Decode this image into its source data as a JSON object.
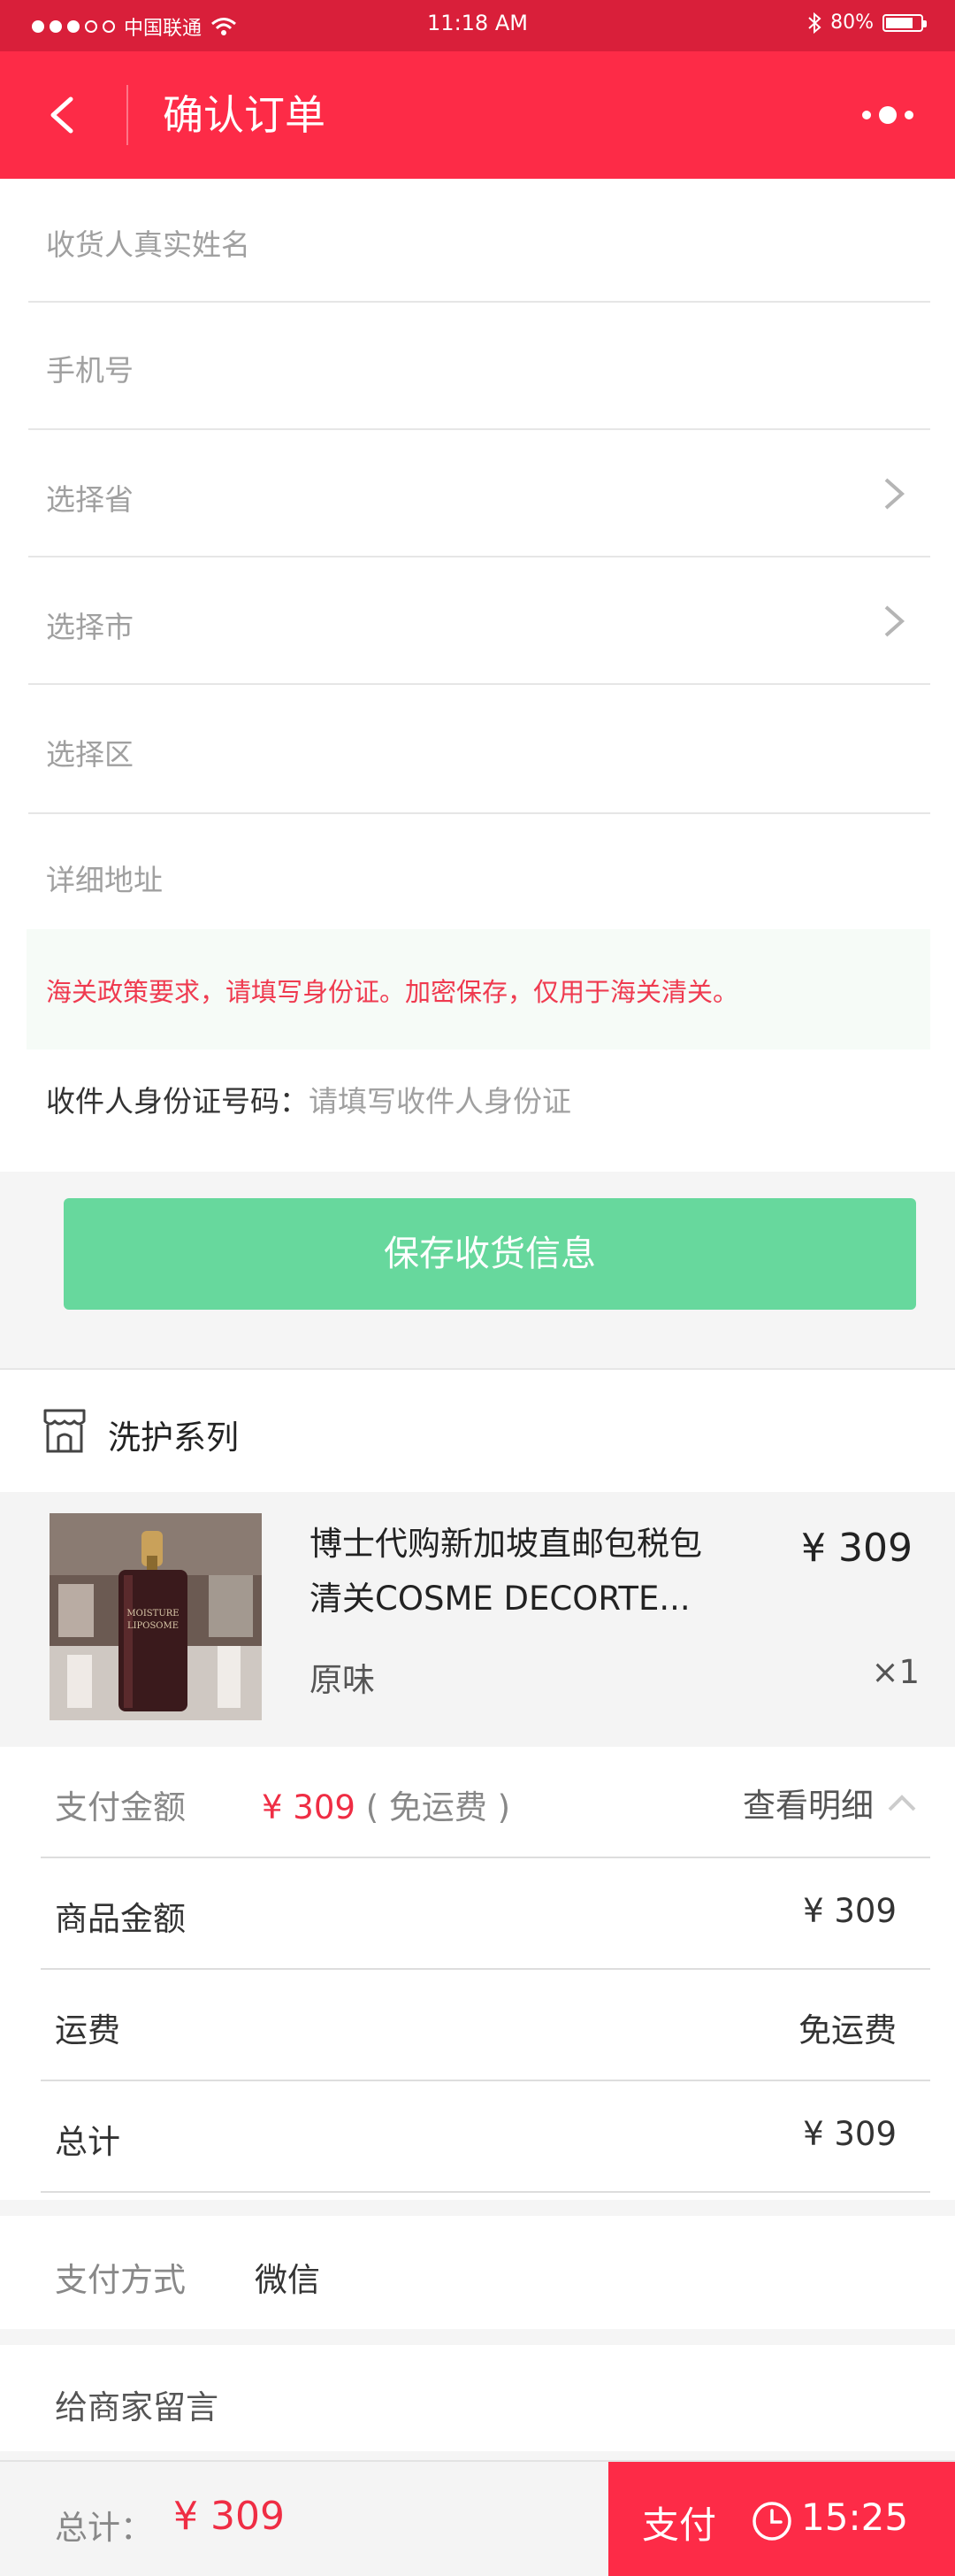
{
  "status_bar": {
    "carrier": "中国联通",
    "time": "11:18 AM",
    "battery": "80%",
    "battery_level": 0.8
  },
  "header": {
    "title": "确认订单"
  },
  "form": {
    "name_placeholder": "收货人真实姓名",
    "phone_placeholder": "手机号",
    "province_placeholder": "选择省",
    "city_placeholder": "选择市",
    "district_placeholder": "选择区",
    "address_placeholder": "详细地址",
    "notice": "海关政策要求，请填写身份证。加密保存，仅用于海关清关。",
    "id_label": "收件人身份证号码：",
    "id_placeholder": "请填写收件人身份证"
  },
  "save_button": "保存收货信息",
  "store": {
    "name": "洗护系列"
  },
  "product": {
    "title": "博士代购新加坡直邮包税包清关COSME DECORTE...",
    "price": "¥ 309",
    "variant": "原味",
    "quantity": "×1",
    "image_text": "MOISTURE LIPOSOME"
  },
  "payment": {
    "amount_label": "支付金额",
    "amount": "¥ 309",
    "shipping_note": "( 免运费 )",
    "detail_link": "查看明细",
    "goods_label": "商品金额",
    "goods_value": "¥ 309",
    "shipping_label": "运费",
    "shipping_value": "免运费",
    "total_label": "总计",
    "total_value": "¥ 309"
  },
  "pay_method": {
    "label": "支付方式",
    "value": "微信"
  },
  "message": {
    "label": "给商家留言"
  },
  "bottom": {
    "total_label": "总计：",
    "total_value": "¥ 309",
    "pay_label": "支付",
    "countdown": "15:25"
  },
  "colors": {
    "brand_red": "#fd2b47",
    "status_red": "#d91f3a",
    "save_green": "#67d89d",
    "price_red": "#ef2d44"
  }
}
